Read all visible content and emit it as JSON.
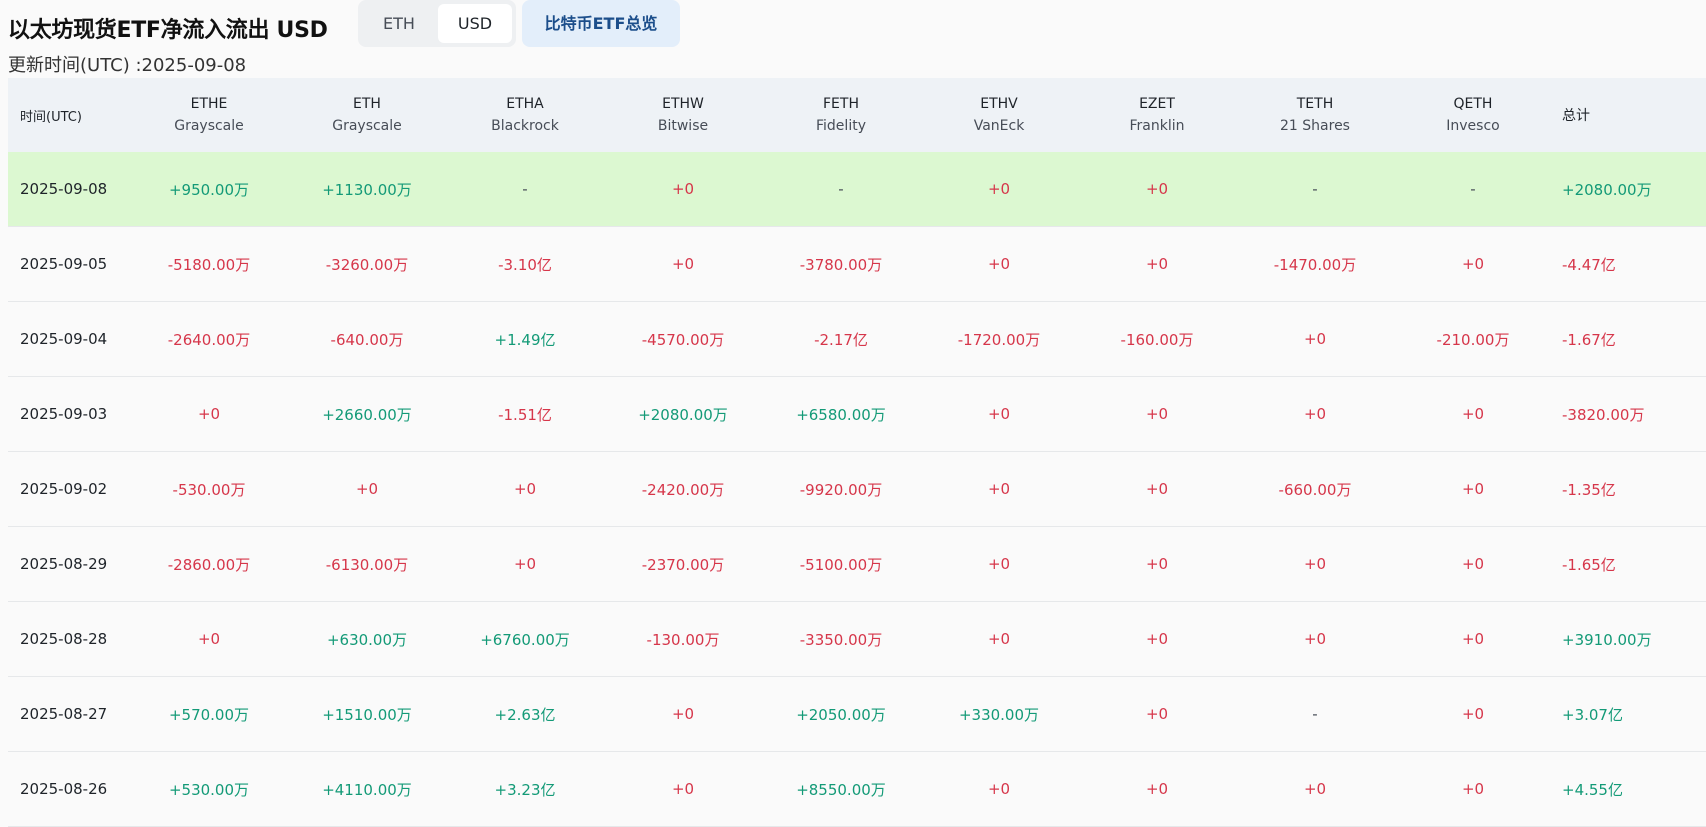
{
  "header": {
    "title": "以太坊现货ETF净流入流出 USD",
    "unit_toggle": {
      "eth_label": "ETH",
      "usd_label": "USD",
      "selected": "USD"
    },
    "btc_overview_label": "比特币ETF总览",
    "update_time": "更新时间(UTC) :2025-09-08"
  },
  "colors": {
    "positive": "#139a77",
    "negative": "#d6364a",
    "highlight_row": "#dcf8d1",
    "header_bg": "#eef2f6"
  },
  "table": {
    "date_header": "时间(UTC)",
    "total_header": "总计",
    "columns": [
      {
        "code": "ETHE",
        "issuer": "Grayscale"
      },
      {
        "code": "ETH",
        "issuer": "Grayscale"
      },
      {
        "code": "ETHA",
        "issuer": "Blackrock"
      },
      {
        "code": "ETHW",
        "issuer": "Bitwise"
      },
      {
        "code": "FETH",
        "issuer": "Fidelity"
      },
      {
        "code": "ETHV",
        "issuer": "VanEck"
      },
      {
        "code": "EZET",
        "issuer": "Franklin"
      },
      {
        "code": "TETH",
        "issuer": "21 Shares"
      },
      {
        "code": "QETH",
        "issuer": "Invesco"
      }
    ],
    "rows": [
      {
        "date": "2025-09-08",
        "values": [
          "+950.00万",
          "+1130.00万",
          "-",
          "+0",
          "-",
          "+0",
          "+0",
          "-",
          "-"
        ],
        "total": "+2080.00万"
      },
      {
        "date": "2025-09-05",
        "values": [
          "-5180.00万",
          "-3260.00万",
          "-3.10亿",
          "+0",
          "-3780.00万",
          "+0",
          "+0",
          "-1470.00万",
          "+0"
        ],
        "total": "-4.47亿"
      },
      {
        "date": "2025-09-04",
        "values": [
          "-2640.00万",
          "-640.00万",
          "+1.49亿",
          "-4570.00万",
          "-2.17亿",
          "-1720.00万",
          "-160.00万",
          "+0",
          "-210.00万"
        ],
        "total": "-1.67亿"
      },
      {
        "date": "2025-09-03",
        "values": [
          "+0",
          "+2660.00万",
          "-1.51亿",
          "+2080.00万",
          "+6580.00万",
          "+0",
          "+0",
          "+0",
          "+0"
        ],
        "total": "-3820.00万"
      },
      {
        "date": "2025-09-02",
        "values": [
          "-530.00万",
          "+0",
          "+0",
          "-2420.00万",
          "-9920.00万",
          "+0",
          "+0",
          "-660.00万",
          "+0"
        ],
        "total": "-1.35亿"
      },
      {
        "date": "2025-08-29",
        "values": [
          "-2860.00万",
          "-6130.00万",
          "+0",
          "-2370.00万",
          "-5100.00万",
          "+0",
          "+0",
          "+0",
          "+0"
        ],
        "total": "-1.65亿"
      },
      {
        "date": "2025-08-28",
        "values": [
          "+0",
          "+630.00万",
          "+6760.00万",
          "-130.00万",
          "-3350.00万",
          "+0",
          "+0",
          "+0",
          "+0"
        ],
        "total": "+3910.00万"
      },
      {
        "date": "2025-08-27",
        "values": [
          "+570.00万",
          "+1510.00万",
          "+2.63亿",
          "+0",
          "+2050.00万",
          "+330.00万",
          "+0",
          "-",
          "+0"
        ],
        "total": "+3.07亿"
      },
      {
        "date": "2025-08-26",
        "values": [
          "+530.00万",
          "+4110.00万",
          "+3.23亿",
          "+0",
          "+8550.00万",
          "+0",
          "+0",
          "+0",
          "+0"
        ],
        "total": "+4.55亿"
      }
    ]
  }
}
